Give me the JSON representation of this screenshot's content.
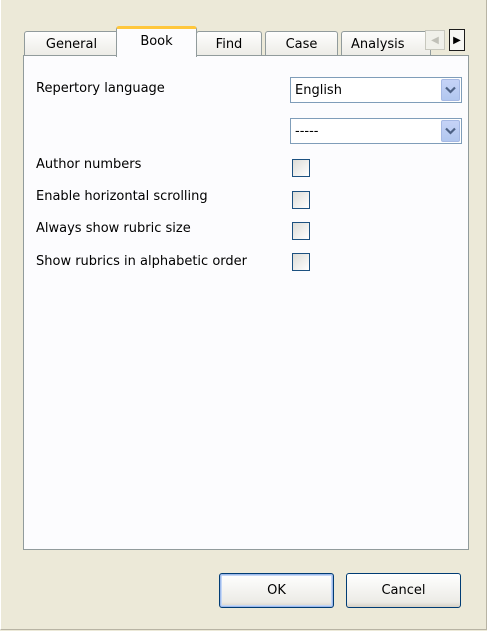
{
  "tabs": [
    {
      "label": "General"
    },
    {
      "label": "Book"
    },
    {
      "label": "Find"
    },
    {
      "label": "Case"
    },
    {
      "label": "Analysis"
    }
  ],
  "active_tab": "Book",
  "book": {
    "repertory_language_label": "Repertory language",
    "language_select": {
      "value": "English"
    },
    "secondary_select": {
      "value": "-----"
    },
    "options": [
      {
        "label": "Author numbers",
        "checked": false
      },
      {
        "label": "Enable horizontal scrolling",
        "checked": false
      },
      {
        "label": "Always show rubric size",
        "checked": false
      },
      {
        "label": "Show rubrics in alphabetic order",
        "checked": false
      }
    ]
  },
  "buttons": {
    "ok": "OK",
    "cancel": "Cancel"
  },
  "colors": {
    "active_tab_accent": "#ffc73c",
    "dropdown_arrow": "#4d6185"
  }
}
